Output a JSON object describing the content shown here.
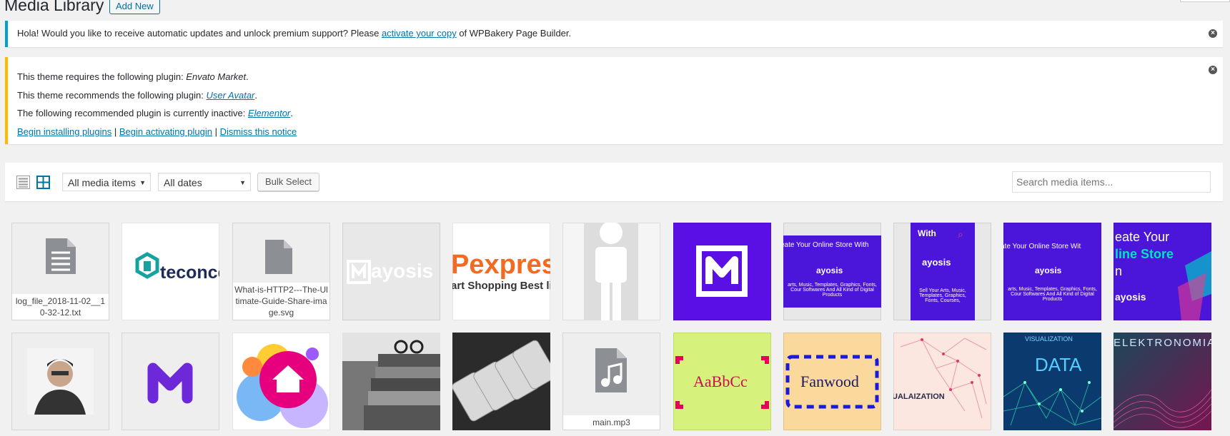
{
  "header": {
    "title": "Media Library",
    "add_new": "Add New"
  },
  "notice_info": {
    "before": "Hola! Would you like to receive automatic updates and unlock premium support? Please ",
    "link": "activate your copy",
    "after": " of WPBakery Page Builder."
  },
  "notice_plugins": {
    "line1_prefix": "This theme requires the following plugin: ",
    "line1_plugin": "Envato Market",
    "line2_prefix": "This theme recommends the following plugin: ",
    "line2_plugin": "User Avatar",
    "line3_prefix": "The following recommended plugin is currently inactive: ",
    "line3_plugin": "Elementor",
    "dot": ".",
    "action1": "Begin installing plugins",
    "action2": "Begin activating plugin",
    "action3": "Dismiss this notice",
    "sep": " | "
  },
  "toolbar": {
    "filter_type": "All media items",
    "filter_date": "All dates",
    "bulk_select": "Bulk Select",
    "search_placeholder": "Search media items..."
  },
  "media": {
    "file1": "log_file_2018-11-02__10-32-12.txt",
    "file2": "What-is-HTTP2---The-Ultimate-Guide-Share-image.svg",
    "file3": "main.mp3",
    "teconce": "teconce",
    "mayosis": "ayosis",
    "pexpress": "Pexpres",
    "pexpress_sub": "art Shopping Best liv",
    "banner_a": "eate Your Online Store With",
    "banner_b": "ate Your Online Store Wit",
    "banner_c1": "eate Your",
    "banner_c2": "line Store",
    "banner_c3": "n",
    "banner_sub": "arts, Music, Templates, Graphics, Fonts, Cour Softwares And All Kind of Digital Products",
    "tall_with": "With",
    "tall_sub": "Sell Your Arts, Music, Templates, Graphics, Fonts, Courses,",
    "mayosis_word": "ayosis",
    "aabbcc": "AaBbCc",
    "fanwood": "Fanwood",
    "viz": "UALAIZATION",
    "data": "DATA",
    "visualization": "VISUALIZATION",
    "elektro": "ELEKTRONOMIA"
  },
  "colors": {
    "info_border": "#00a0d2",
    "warn_border": "#ffb900",
    "link": "#0073aa",
    "mayosis_purple": "#5a0fe4"
  }
}
